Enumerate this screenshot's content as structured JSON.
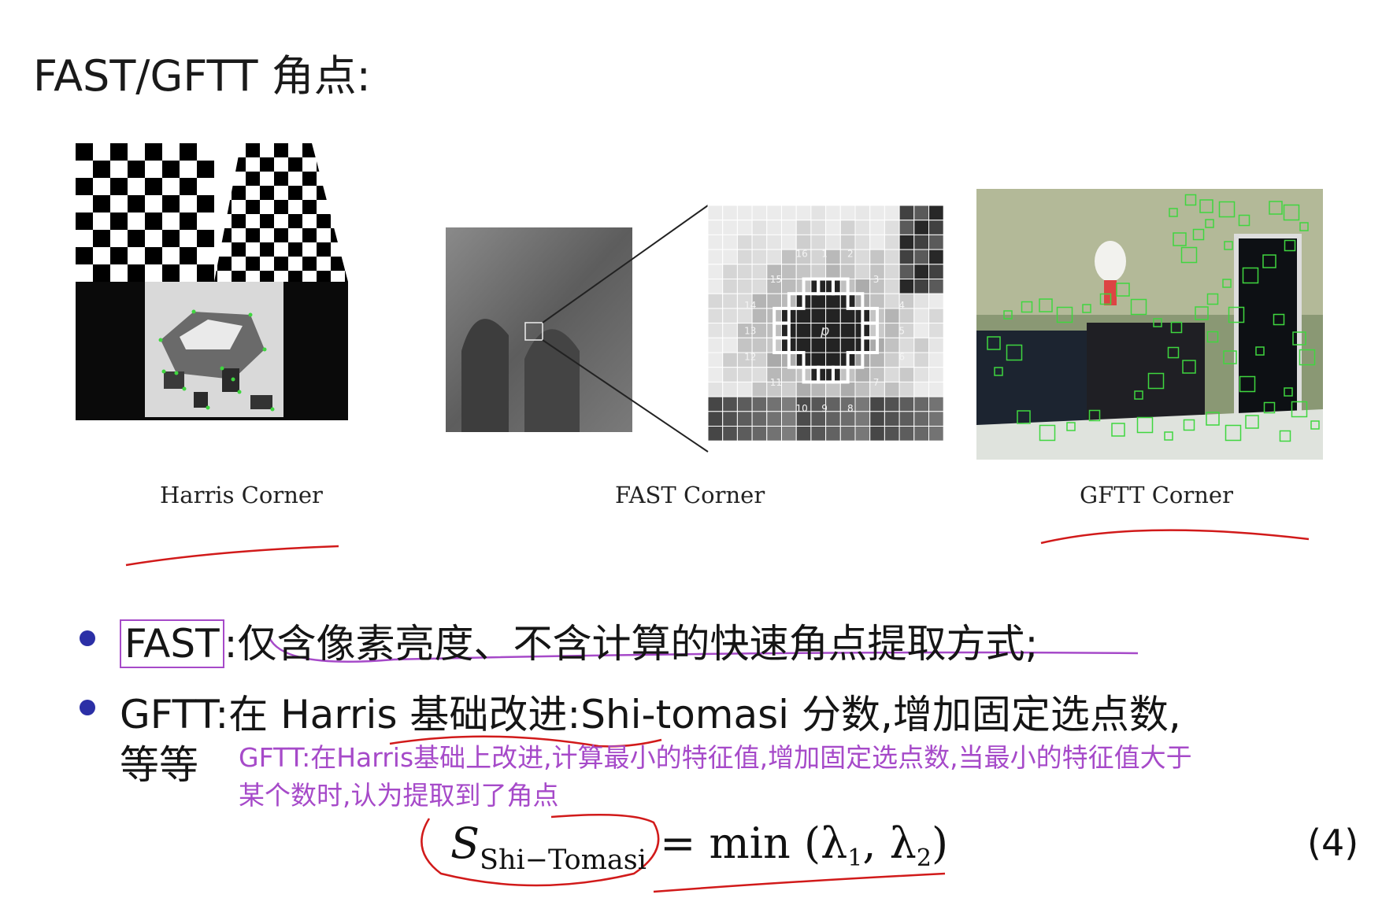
{
  "slide": {
    "title": "FAST/GFTT 角点:",
    "captions": {
      "harris": "Harris Corner",
      "fast": "FAST Corner",
      "gftt": "GFTT Corner"
    },
    "fast_figure": {
      "center_label": "p",
      "circle_numbers": [
        "1",
        "2",
        "3",
        "4",
        "5",
        "6",
        "7",
        "8",
        "9",
        "10",
        "11",
        "12",
        "13",
        "14",
        "15",
        "16"
      ]
    },
    "bullets": [
      {
        "term": "FAST",
        "text": ":仅含像素亮度、不含计算的快速角点提取方式;"
      },
      {
        "term": "GFTT",
        "text": ":在 Harris 基础改进:Shi-tomasi 分数,增加固定选点数,",
        "continuation": "等等"
      }
    ],
    "note": {
      "line1": "GFTT:在Harris基础上改进,计算最小的特征值,增加固定选点数,当最小的特征值大于",
      "line2": "某个数时,认为提取到了角点"
    },
    "formula": {
      "symbol": "S",
      "subscript": "Shi−Tomasi",
      "rhs_prefix": " = min (λ",
      "sub1": "1",
      "mid": ", λ",
      "sub2": "2",
      "rhs_suffix": ")",
      "equation_number": "(4)"
    },
    "colors": {
      "bullet": "#2b2fa6",
      "annotation_red": "#d11a1a",
      "annotation_purple": "#a64ac9",
      "corner_marker_green": "#3fd63f"
    }
  }
}
